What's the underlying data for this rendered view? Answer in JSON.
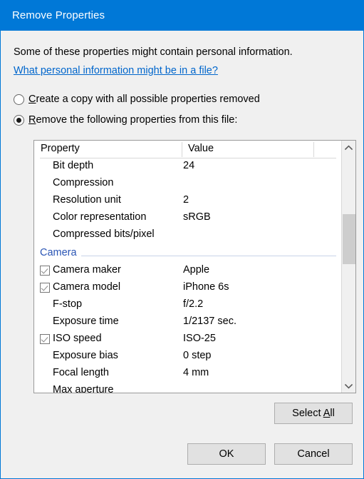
{
  "window": {
    "title": "Remove Properties"
  },
  "content": {
    "description": "Some of these properties might contain personal information.",
    "help_link": "What personal information might be in a file?"
  },
  "options": {
    "radios": [
      {
        "label_before": "",
        "accel": "C",
        "label_after": "reate a copy with all possible properties removed",
        "selected": false
      },
      {
        "label_before": "",
        "accel": "R",
        "label_after": "emove the following properties from this file:",
        "selected": true
      }
    ]
  },
  "property_list": {
    "columns": [
      "Property",
      "Value"
    ],
    "rows": [
      {
        "kind": "item",
        "checkbox": "none",
        "property": "Bit depth",
        "value": "24"
      },
      {
        "kind": "item",
        "checkbox": "none",
        "property": "Compression",
        "value": ""
      },
      {
        "kind": "item",
        "checkbox": "none",
        "property": "Resolution unit",
        "value": "2"
      },
      {
        "kind": "item",
        "checkbox": "none",
        "property": "Color representation",
        "value": "sRGB"
      },
      {
        "kind": "item",
        "checkbox": "none",
        "property": "Compressed bits/pixel",
        "value": ""
      },
      {
        "kind": "group",
        "property": "Camera",
        "value": ""
      },
      {
        "kind": "item",
        "checkbox": "checked",
        "property": "Camera maker",
        "value": "Apple"
      },
      {
        "kind": "item",
        "checkbox": "checked",
        "property": "Camera model",
        "value": "iPhone 6s"
      },
      {
        "kind": "item",
        "checkbox": "none",
        "property": "F-stop",
        "value": "f/2.2"
      },
      {
        "kind": "item",
        "checkbox": "none",
        "property": "Exposure time",
        "value": "1/2137 sec."
      },
      {
        "kind": "item",
        "checkbox": "checked",
        "property": "ISO speed",
        "value": "ISO-25"
      },
      {
        "kind": "item",
        "checkbox": "none",
        "property": "Exposure bias",
        "value": "0 step"
      },
      {
        "kind": "item",
        "checkbox": "none",
        "property": "Focal length",
        "value": "4 mm"
      },
      {
        "kind": "item",
        "checkbox": "none",
        "property": "Max aperture",
        "value": ""
      }
    ]
  },
  "scrollbar": {
    "up_icon": "chevron-up-icon",
    "down_icon": "chevron-down-icon"
  },
  "buttons": {
    "select_all_before": "Select ",
    "select_all_accel": "A",
    "select_all_after": "ll",
    "ok": "OK",
    "cancel": "Cancel"
  },
  "colors": {
    "title_bar": "#0078d7",
    "link": "#0066cc",
    "group_header": "#2a55b5",
    "body_bg": "#f0f0f0"
  }
}
